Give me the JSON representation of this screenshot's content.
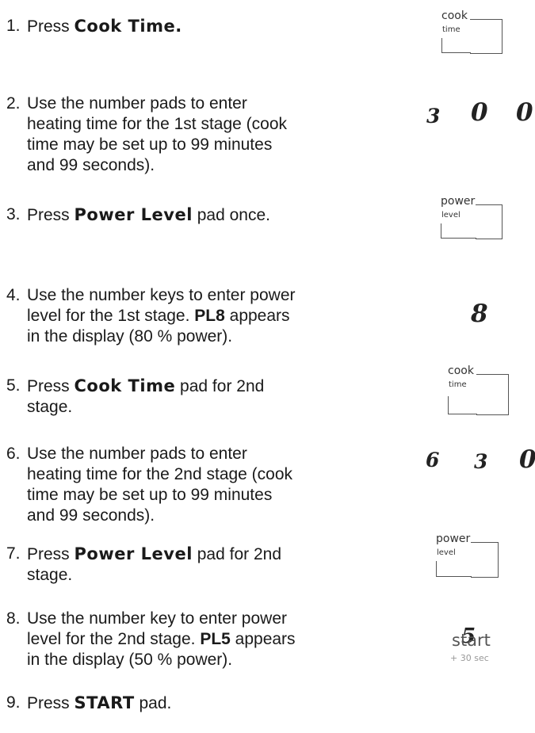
{
  "steps": [
    {
      "n": "1.",
      "a": "Press ",
      "b": "Cook Time",
      "c": "."
    },
    {
      "n": "2.",
      "l1": "Use the number pads to enter",
      "l2": "heating time for the 1st stage (cook",
      "l3": "time may be set up to 99 minutes",
      "l4": "and 99 seconds)."
    },
    {
      "n": "3.",
      "a": "Press ",
      "b": "Power Level",
      "c": " pad once."
    },
    {
      "n": "4.",
      "l1": "Use the number keys to enter power",
      "l2a": "level for the 1st stage. ",
      "l2b": "PL8",
      "l2c": " appears",
      "l3": "in the display (80 % power)."
    },
    {
      "n": "5.",
      "a": "Press ",
      "b": "Cook Time",
      "c": " pad for 2nd",
      "l2": "stage."
    },
    {
      "n": "6.",
      "l1": "Use the number pads to enter",
      "l2": "heating time for the 2nd stage (cook",
      "l3": "time may be set up to 99 minutes",
      "l4": "and 99 seconds)."
    },
    {
      "n": "7.",
      "a": "Press ",
      "b": "Power Level",
      "c": " pad for 2nd",
      "l2": "stage."
    },
    {
      "n": "8.",
      "l1": "Use the number key to enter power",
      "l2a": "level for the 2nd stage. ",
      "l2b": "PL5",
      "l2c": " appears",
      "l3": "in the display (50 % power)."
    },
    {
      "n": "9.",
      "a": "Press ",
      "b": "START",
      "c": " pad."
    }
  ],
  "pads": {
    "cook": {
      "top": "cook",
      "bottom": "time"
    },
    "power": {
      "top": "power",
      "bottom": "level"
    },
    "start": {
      "top": "start",
      "bottom": "+ 30 sec"
    }
  },
  "digits": {
    "stage1_time": [
      "3",
      "0",
      "0"
    ],
    "stage1_power": "8",
    "stage2_time": [
      "6",
      "3",
      "0"
    ],
    "stage2_power": "5"
  }
}
